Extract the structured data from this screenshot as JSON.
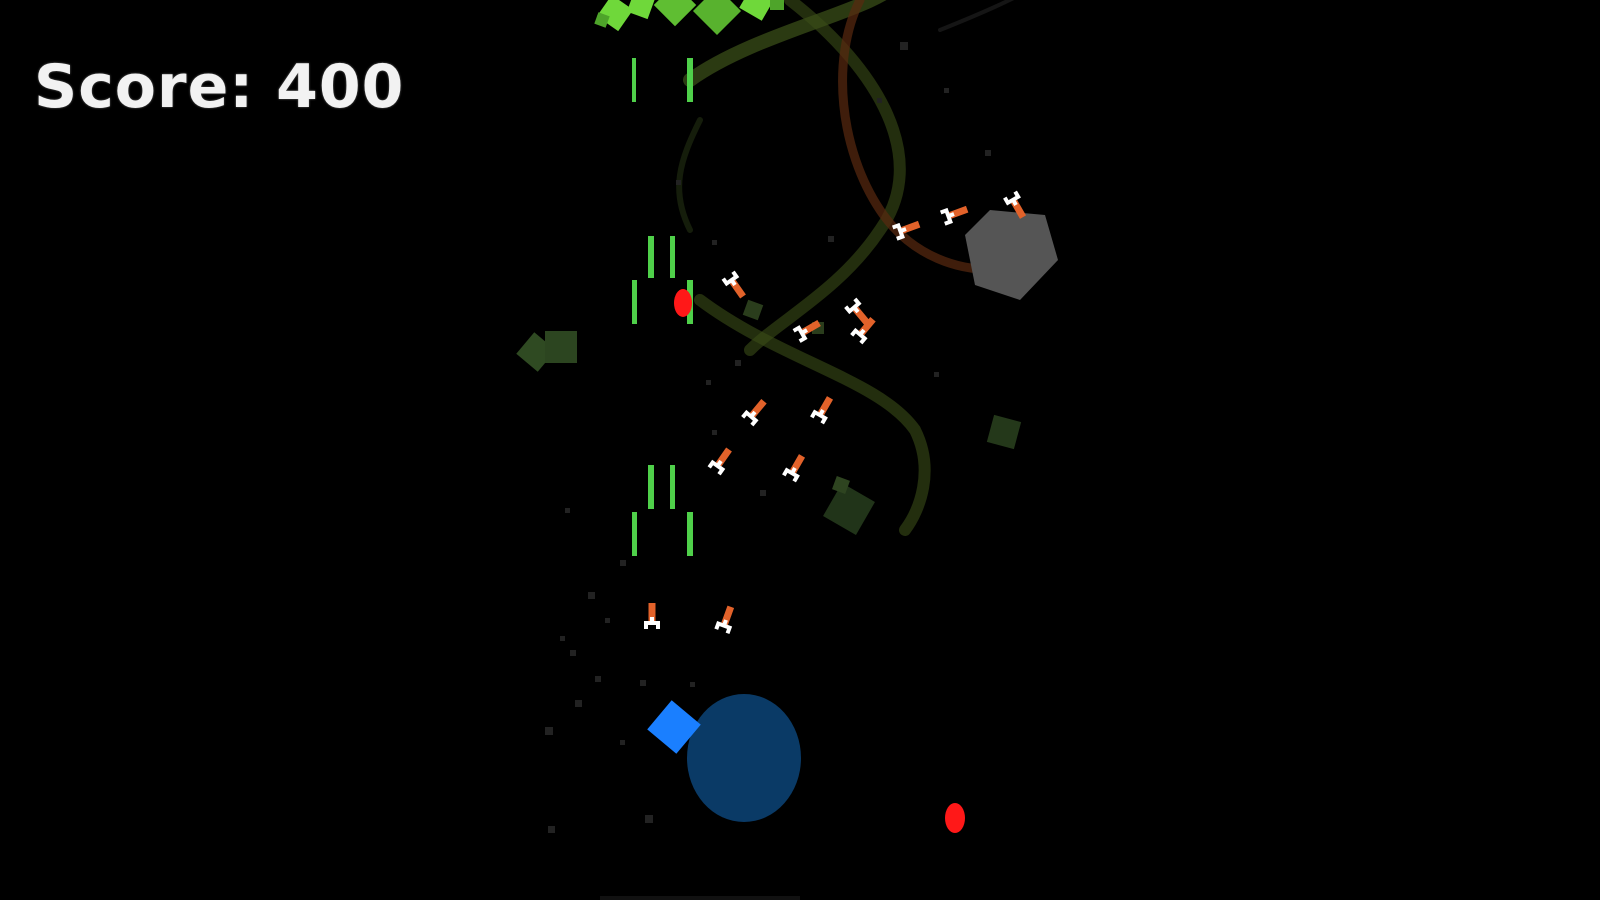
{
  "hud": {
    "score_label": "Score:",
    "score_value": "400"
  },
  "colors": {
    "background": "#000000",
    "laser_green": "#4fd04a",
    "enemy_orange": "#e2622a",
    "enemy_white": "#ffffff",
    "enemy_bullet_red": "#ff1818",
    "player_shield_blue": "#0a3a66",
    "player_ship_blue": "#1a7fff",
    "asteroid_gray": "#555555",
    "debris_green": "#3f6b2a",
    "debris_bright_green": "#6fd83a",
    "trail_green": "#3a4d18",
    "trail_orange": "#5a2a10"
  },
  "icons": {
    "player": "blue-diamond-ship-icon",
    "shield": "shield-bubble-icon",
    "enemy": "drone-enemy-icon",
    "asteroid": "asteroid-icon"
  }
}
